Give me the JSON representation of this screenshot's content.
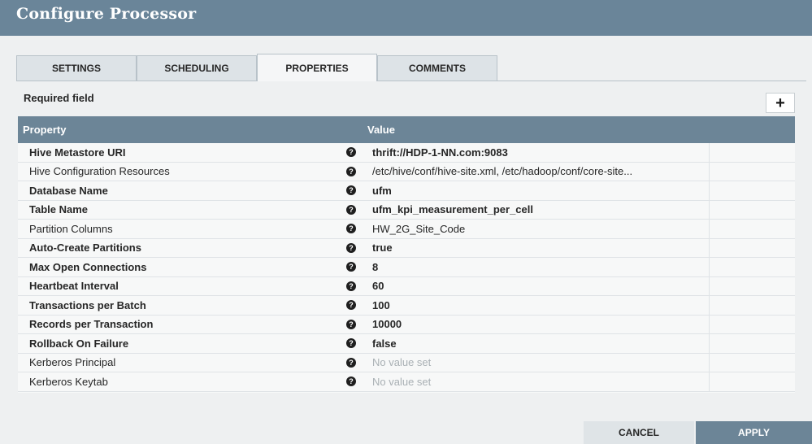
{
  "dialog": {
    "title": "Configure Processor"
  },
  "tabs": [
    {
      "label": "SETTINGS",
      "active": false
    },
    {
      "label": "SCHEDULING",
      "active": false
    },
    {
      "label": "PROPERTIES",
      "active": true
    },
    {
      "label": "COMMENTS",
      "active": false
    }
  ],
  "properties_panel": {
    "required_label": "Required field",
    "add_label": "+",
    "columns": {
      "property": "Property",
      "value": "Value"
    },
    "help_glyph": "?",
    "rows": [
      {
        "name": "Hive Metastore URI",
        "value": "thrift://HDP-1-NN.com:9083",
        "required": true,
        "set": true
      },
      {
        "name": "Hive Configuration Resources",
        "value": "/etc/hive/conf/hive-site.xml, /etc/hadoop/conf/core-site...",
        "required": false,
        "set": true
      },
      {
        "name": "Database Name",
        "value": "ufm",
        "required": true,
        "set": true
      },
      {
        "name": "Table Name",
        "value": "ufm_kpi_measurement_per_cell",
        "required": true,
        "set": true
      },
      {
        "name": "Partition Columns",
        "value": "HW_2G_Site_Code",
        "required": false,
        "set": true
      },
      {
        "name": "Auto-Create Partitions",
        "value": "true",
        "required": true,
        "set": true
      },
      {
        "name": "Max Open Connections",
        "value": "8",
        "required": true,
        "set": true
      },
      {
        "name": "Heartbeat Interval",
        "value": "60",
        "required": true,
        "set": true
      },
      {
        "name": "Transactions per Batch",
        "value": "100",
        "required": true,
        "set": true
      },
      {
        "name": "Records per Transaction",
        "value": "10000",
        "required": true,
        "set": true
      },
      {
        "name": "Rollback On Failure",
        "value": "false",
        "required": true,
        "set": true
      },
      {
        "name": "Kerberos Principal",
        "value": "No value set",
        "required": false,
        "set": false
      },
      {
        "name": "Kerberos Keytab",
        "value": "No value set",
        "required": false,
        "set": false
      }
    ]
  },
  "footer": {
    "cancel_label": "CANCEL",
    "apply_label": "APPLY"
  },
  "colors": {
    "header": "#6a8599",
    "grid_header": "#6c8597",
    "apply": "#6c8597"
  }
}
